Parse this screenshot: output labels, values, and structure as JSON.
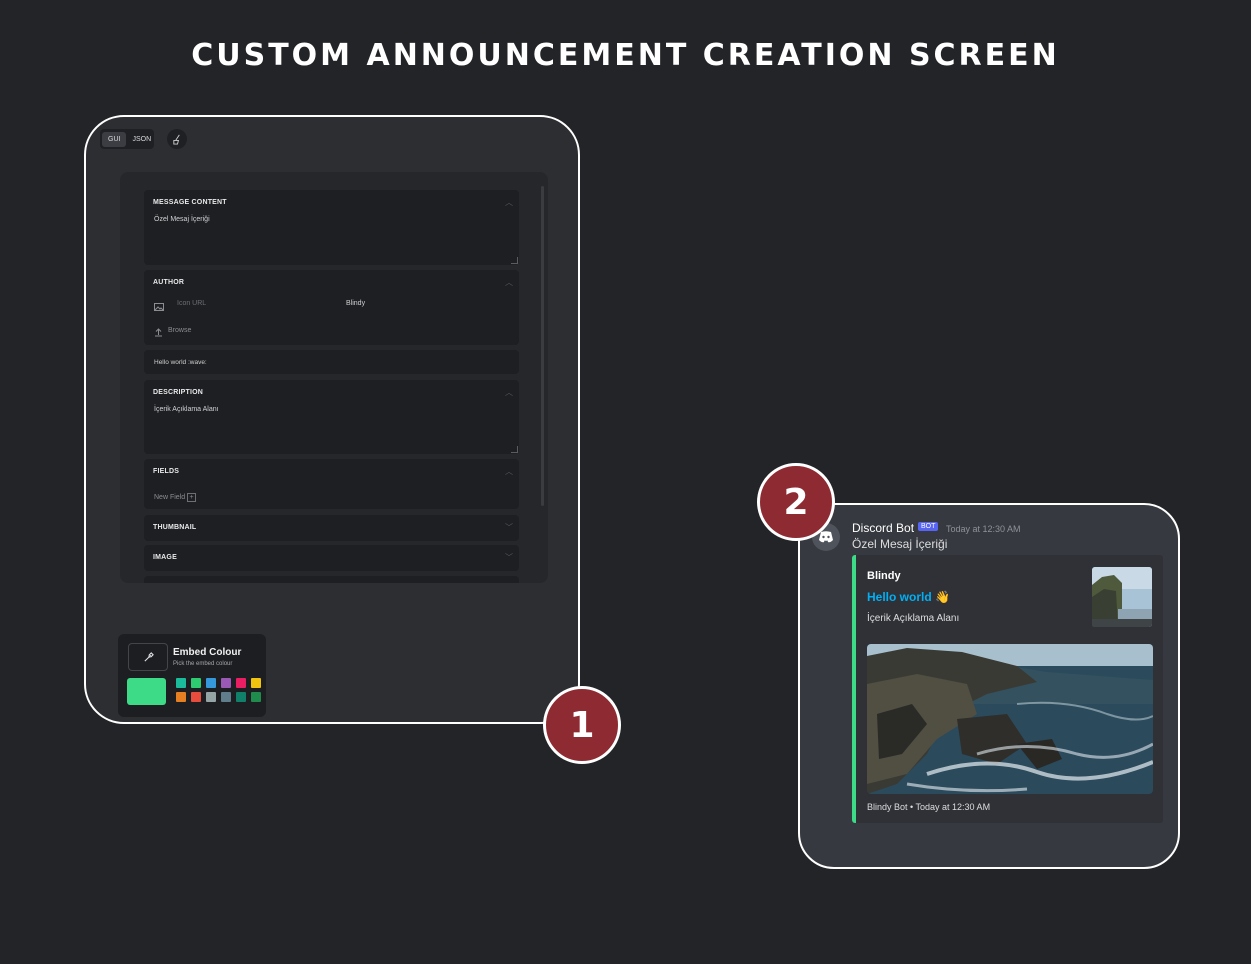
{
  "page_title": "CUSTOM ANNOUNCEMENT CREATION SCREEN",
  "editor": {
    "modes": [
      "GUI",
      "JSON"
    ],
    "active_mode": "GUI",
    "message_content": {
      "title": "MESSAGE CONTENT",
      "value": "Özel Mesaj İçeriği"
    },
    "author": {
      "title": "AUTHOR",
      "icon_url_placeholder": "Icon URL",
      "name": "Blindy",
      "browse_label": "Browse"
    },
    "title_value": "Hello  world :wave:",
    "description": {
      "title": "DESCRIPTION",
      "value": "İçerik Açıklama Alanı"
    },
    "fields": {
      "title": "FIELDS",
      "new_field_label": "New Field"
    },
    "thumbnail_title": "THUMBNAIL",
    "image_title": "IMAGE",
    "embed_colour": {
      "title": "Embed Colour",
      "subtitle": "Pick the embed colour",
      "selected": "#3dda87",
      "swatches": [
        "#1abc9c",
        "#2ecc71",
        "#3498db",
        "#9b59b6",
        "#e91e63",
        "#f1c40f",
        "#e67e22",
        "#e74c3c",
        "#95a5a6",
        "#607d8b",
        "#11806a",
        "#1f8b4c"
      ]
    }
  },
  "badges": {
    "one": "1",
    "two": "2"
  },
  "preview": {
    "bot_name": "Discord Bot",
    "bot_tag": "BOT",
    "timestamp": "Today at 12:30 AM",
    "message": "Özel Mesaj İçeriği",
    "embed": {
      "author": "Blindy",
      "title": "Hello world",
      "title_emoji": "👋",
      "description": "İçerik Açıklama Alanı",
      "footer": "Blindy Bot  • Today at 12:30 AM",
      "color": "#3dda87"
    }
  }
}
